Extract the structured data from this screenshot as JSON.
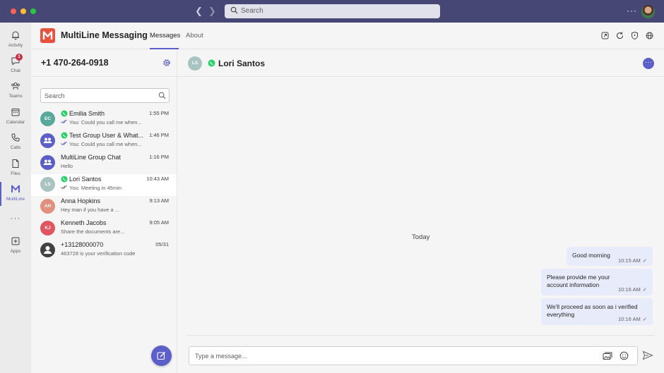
{
  "titlebar": {
    "search_placeholder": "Search",
    "more": "···"
  },
  "rail": {
    "items": [
      {
        "label": "Activity",
        "icon": "bell-icon"
      },
      {
        "label": "Chat",
        "icon": "chat-icon",
        "badge": "1"
      },
      {
        "label": "Teams",
        "icon": "teams-icon"
      },
      {
        "label": "Calendar",
        "icon": "calendar-icon"
      },
      {
        "label": "Calls",
        "icon": "phone-icon"
      },
      {
        "label": "Files",
        "icon": "file-icon"
      },
      {
        "label": "MultiLine",
        "icon": "multiline-icon",
        "active": true
      },
      {
        "label": "Apps",
        "icon": "plus-square-icon"
      }
    ],
    "more": "···"
  },
  "header": {
    "app_name": "MultiLine Messaging",
    "tabs": [
      {
        "label": "Messages",
        "active": true
      },
      {
        "label": "About"
      }
    ]
  },
  "sidebar": {
    "phone_number": "+1 470-264-0918",
    "search_placeholder": "Search",
    "conversations": [
      {
        "initials": "EC",
        "name": "Emilia Smith",
        "time": "1:55 PM",
        "preview": "You: Could you call me when...",
        "whatsapp": true,
        "ticks": true,
        "color": "#58a89b"
      },
      {
        "initials": "",
        "name": "Test Group User & What...",
        "time": "1:46 PM",
        "preview": "You: Could you call me when...",
        "whatsapp": true,
        "ticks": true,
        "color": "#5b5fc7"
      },
      {
        "initials": "",
        "name": "MultiLine Group Chat",
        "time": "1:16 PM",
        "preview": "Hello",
        "whatsapp": false,
        "ticks": false,
        "color": "#5b5fc7"
      },
      {
        "initials": "LS",
        "name": "Lori Santos",
        "time": "10:43 AM",
        "preview": "You: Meeting in 45min",
        "whatsapp": true,
        "ticks": true,
        "color": "#a9c4c1",
        "selected": true
      },
      {
        "initials": "AH",
        "name": "Anna Hopkins",
        "time": "9:13 AM",
        "preview": "Hey man if you have a ...",
        "whatsapp": false,
        "ticks": false,
        "color": "#e0907c"
      },
      {
        "initials": "KJ",
        "name": "Kenneth Jacobs",
        "time": "9:05 AM",
        "preview": "Share the documents are...",
        "whatsapp": false,
        "ticks": false,
        "color": "#e0555f"
      },
      {
        "initials": "",
        "name": "+13128000070",
        "time": "05/31",
        "preview": "463728 is your verification code",
        "whatsapp": false,
        "ticks": false,
        "color": "#424242"
      }
    ]
  },
  "chat": {
    "contact_initials": "LS",
    "contact_name": "Lori Santos",
    "day_separator": "Today",
    "messages": [
      {
        "text": "Good morning",
        "time": "10:15 AM"
      },
      {
        "text": "Please provide me your account information",
        "time": "10:16 AM"
      },
      {
        "text": "We'll proceed as soon as i verified everything",
        "time": "10:16 AM"
      }
    ],
    "composer_placeholder": "Type a message..."
  },
  "colors": {
    "titlebar": "#464775",
    "accent": "#5b5fc7",
    "whatsapp": "#25d366",
    "bubble": "#e8ebfa",
    "logo": "#e8533f"
  }
}
